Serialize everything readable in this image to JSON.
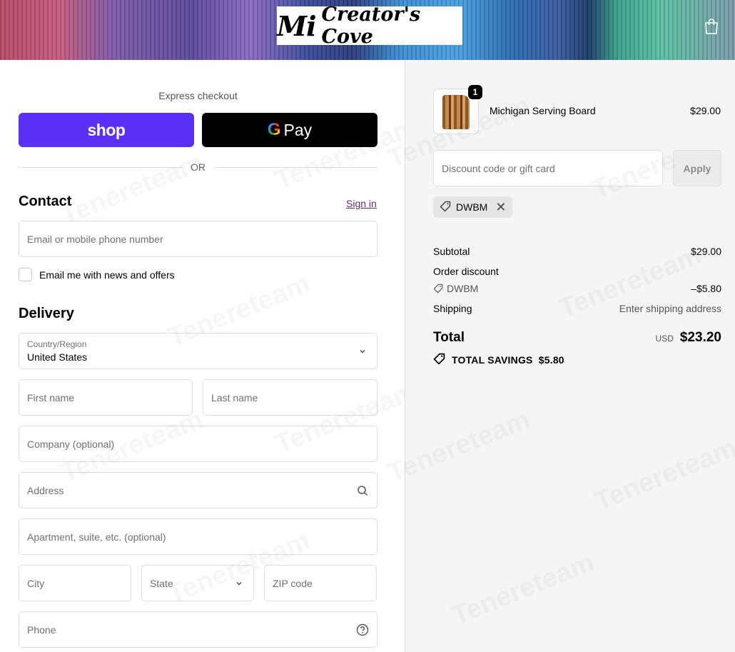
{
  "header": {
    "logo_mi": "Mi",
    "logo_rest": "Creator's Cove"
  },
  "express": {
    "label": "Express checkout",
    "shop_label": "shop",
    "gpay_g": "G",
    "gpay_label": "Pay",
    "or": "OR"
  },
  "contact": {
    "title": "Contact",
    "sign_in": "Sign in",
    "email_placeholder": "Email or mobile phone number",
    "newsletter": "Email me with news and offers"
  },
  "delivery": {
    "title": "Delivery",
    "country_label": "Country/Region",
    "country_value": "United States",
    "first_name": "First name",
    "last_name": "Last name",
    "company": "Company (optional)",
    "address": "Address",
    "apartment": "Apartment, suite, etc. (optional)",
    "city": "City",
    "state": "State",
    "zip": "ZIP code",
    "phone": "Phone"
  },
  "summary": {
    "product_name": "Michigan Serving Board",
    "product_price": "$29.00",
    "quantity": "1",
    "discount_placeholder": "Discount code or gift card",
    "apply": "Apply",
    "code": "DWBM",
    "subtotal_label": "Subtotal",
    "subtotal_value": "$29.00",
    "order_discount_label": "Order discount",
    "order_discount_code": "DWBM",
    "order_discount_value": "–$5.80",
    "shipping_label": "Shipping",
    "shipping_value": "Enter shipping address",
    "total_label": "Total",
    "currency": "USD",
    "total_value": "$23.20",
    "savings": "TOTAL SAVINGS  $5.80"
  }
}
